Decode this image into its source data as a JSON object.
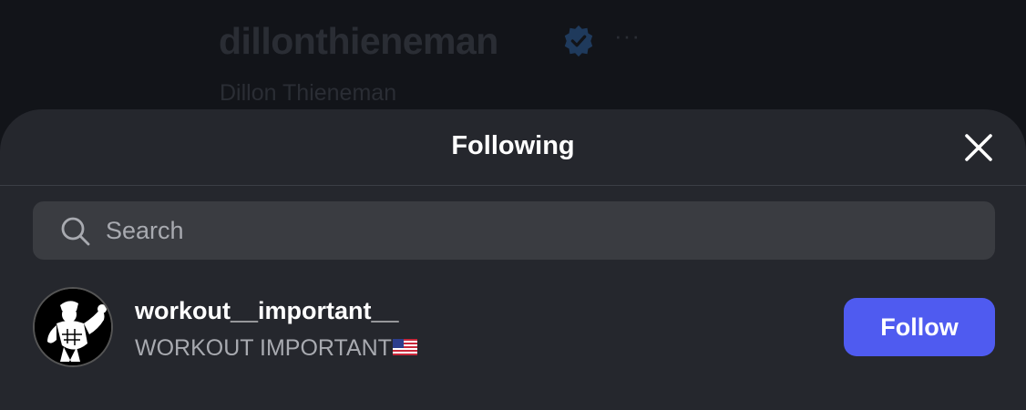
{
  "background_profile": {
    "username": "dillonthieneman",
    "full_name": "Dillon Thieneman",
    "more_glyph": "···"
  },
  "modal": {
    "title": "Following",
    "search": {
      "placeholder": "Search",
      "value": ""
    },
    "users": [
      {
        "handle": "workout__important__",
        "display_name": "WORKOUT IMPORTANT",
        "follow_label": "Follow"
      }
    ]
  },
  "colors": {
    "follow_button": "#4f5bf0",
    "modal_bg": "#25272d",
    "search_bg": "#3a3c41"
  }
}
